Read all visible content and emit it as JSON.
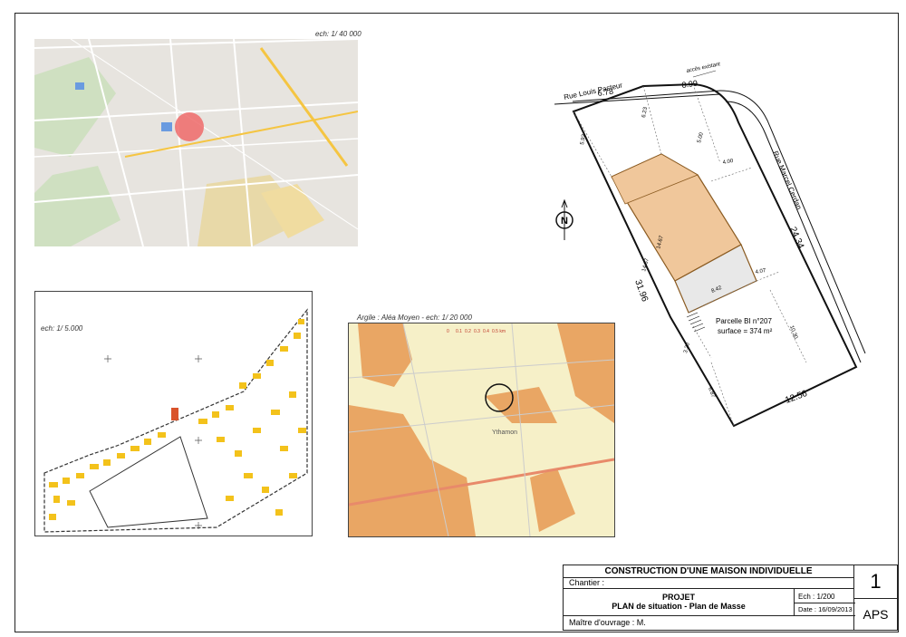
{
  "maps": {
    "situation": {
      "scale": "ech: 1/ 40 000"
    },
    "cadastre": {
      "scale": "ech: 1/ 5.000"
    },
    "argiles": {
      "scale": "Argile : Aléa Moyen - ech: 1/ 20 000",
      "place": "Ythamon"
    }
  },
  "plan": {
    "street_north": "Rue Louis Pasteur",
    "street_east": "Rue Marcel Cerdan",
    "access": "accès existant",
    "north": "N",
    "dims": {
      "d678": "6.78",
      "d899": "8.99",
      "d623": "6.23",
      "d592": "5.92",
      "d500": "5.00",
      "d400": "4.00",
      "d1467a": "14.67",
      "d1467b": "14.67",
      "d2434": "24.34",
      "d3196": "31.96",
      "d407": "4.07",
      "d842": "8.42",
      "d1030": "10.30",
      "d320": "3.20",
      "d687": "6.87",
      "d1256": "12.56"
    },
    "parcel_line1": "Parcelle BI n°207",
    "parcel_line2": "surface = 374 m²"
  },
  "cartouche": {
    "title": "CONSTRUCTION D'UNE MAISON INDIVIDUELLE",
    "chantier": "Chantier :",
    "projet": "PROJET",
    "subtitle": "PLAN de situation - Plan de Masse",
    "ech": "Ech : 1/200",
    "date": "Date : 16/09/2013",
    "maitre": "Maître d'ouvrage :  M.",
    "number": "1",
    "phase": "APS"
  },
  "colors": {
    "house": "#f0c79b",
    "garage": "#e8e8e8",
    "marker": "#ef6a6a",
    "clay": "#e9a664",
    "map_bg": "#e7e4df",
    "building": "#f3c21b"
  }
}
